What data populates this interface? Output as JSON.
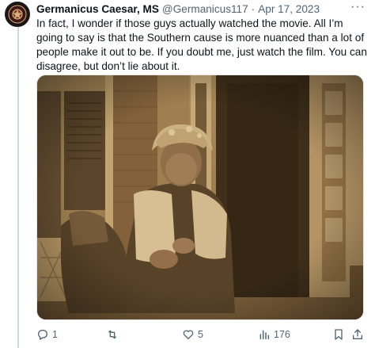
{
  "tweet": {
    "author_name": "Germanicus Caesar, MS",
    "handle": "@Germanicus117",
    "separator": "·",
    "date": "Apr 17, 2023",
    "more_label": "···",
    "text": "In fact, I wonder if those guys actually watched the movie. All I’m going to say is that the Southern cause is more nuanced than a lot of people make it out to be. If you doubt me, just watch the film. You can disagree, but don’t lie about it."
  },
  "actions": {
    "replies": "1",
    "retweets": "",
    "likes": "5",
    "views": "176"
  },
  "icons": {
    "avatar": "avatar-emblem-icon",
    "reply": "reply-icon",
    "retweet": "retweet-icon",
    "like": "heart-icon",
    "views": "views-chart-icon",
    "bookmark": "bookmark-icon",
    "share": "share-icon"
  },
  "colors": {
    "text": "#0f1419",
    "secondary": "#536471",
    "rail": "#cfd9de"
  }
}
